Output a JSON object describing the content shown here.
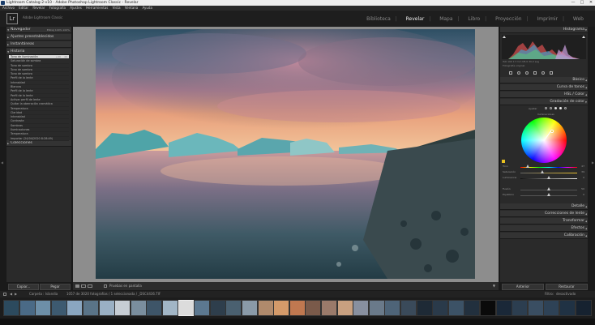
{
  "window": {
    "title": "Lightroom Catalog-2-v10 - Adobe Photoshop Lightroom Classic - Revelar",
    "min": "—",
    "max": "□",
    "close": "✕"
  },
  "menu": [
    "Archivo",
    "Editar",
    "Revelar",
    "Fotografía",
    "Ajustes",
    "Herramientas",
    "Vista",
    "Ventana",
    "Ayuda"
  ],
  "identity": {
    "logo": "Lr",
    "catalog": "Adobe Lightroom Classic"
  },
  "modules": [
    {
      "label": "Biblioteca",
      "active": false
    },
    {
      "label": "Revelar",
      "active": true
    },
    {
      "label": "Mapa",
      "active": false
    },
    {
      "label": "Libro",
      "active": false
    },
    {
      "label": "Proyección",
      "active": false
    },
    {
      "label": "Imprimir",
      "active": false
    },
    {
      "label": "Web",
      "active": false
    }
  ],
  "left_panel": {
    "navigator": "Navegador",
    "navigator_zoom": "ENCAJ  100%  100%",
    "presets": "Ajustes preestablecidos",
    "snapshots": "Instantáneas",
    "history": "Historia",
    "collections": "Colecciones",
    "history_items": [
      {
        "label": "Tono de iluminación",
        "v1": "+46",
        "v2": "46",
        "selected": true
      },
      {
        "label": "Saturación de sombra",
        "v1": "",
        "v2": "",
        "selected": false
      },
      {
        "label": "Tono de sombra",
        "v1": "",
        "v2": "",
        "selected": false
      },
      {
        "label": "Tono de sombra",
        "v1": "",
        "v2": "",
        "selected": false
      },
      {
        "label": "Tono de sombra",
        "v1": "",
        "v2": "",
        "selected": false
      },
      {
        "label": "Perfil de la lente",
        "v1": "",
        "v2": "",
        "selected": false
      },
      {
        "label": "Intensidad",
        "v1": "",
        "v2": "",
        "selected": false
      },
      {
        "label": "Blancos",
        "v1": "",
        "v2": "",
        "selected": false
      },
      {
        "label": "Perfil de la lente",
        "v1": "",
        "v2": "",
        "selected": false
      },
      {
        "label": "Perfil de la lente",
        "v1": "",
        "v2": "",
        "selected": false
      },
      {
        "label": "Activar perfil de lente",
        "v1": "",
        "v2": "",
        "selected": false
      },
      {
        "label": "Quitar la aberración cromática",
        "v1": "",
        "v2": "",
        "selected": false
      },
      {
        "label": "Temperatura",
        "v1": "",
        "v2": "",
        "selected": false
      },
      {
        "label": "Claridad",
        "v1": "",
        "v2": "",
        "selected": false
      },
      {
        "label": "Intensidad",
        "v1": "",
        "v2": "",
        "selected": false
      },
      {
        "label": "Contraste",
        "v1": "",
        "v2": "",
        "selected": false
      },
      {
        "label": "Sombras",
        "v1": "",
        "v2": "",
        "selected": false
      },
      {
        "label": "Iluminaciones",
        "v1": "",
        "v2": "",
        "selected": false
      },
      {
        "label": "Temperatura",
        "v1": "",
        "v2": "",
        "selected": false
      },
      {
        "label": "Importar (24/04/2020 8:28:49)",
        "v1": "",
        "v2": "",
        "selected": false
      }
    ],
    "copy_btn": "Copiar...",
    "paste_btn": "Pegar"
  },
  "right_panel": {
    "histogram": "Histograma",
    "hist_stats": "ISO 100   17 mm   f/8,0   30,0 seg",
    "original_photo": "Fotografía original",
    "basic": "Básico",
    "tone_curve": "Curva de tonos",
    "hsl": "HSL / Color",
    "grading": "Gradación de color",
    "grading_adjust": "Ajustar",
    "grading_wheel_label": "Iluminaciones",
    "sliders": [
      {
        "label": "Tono",
        "value": "47",
        "pos": 0.13
      },
      {
        "label": "Saturación",
        "value": "39",
        "pos": 0.39
      },
      {
        "label": "Luminancia",
        "value": "0",
        "pos": 0.5
      },
      {
        "label": "Fusión",
        "value": "50",
        "pos": 0.5
      },
      {
        "label": "Equilibrio",
        "value": "0",
        "pos": 0.5
      }
    ],
    "detail": "Detalle",
    "lens": "Correcciones de lente",
    "transform": "Transformar",
    "effects": "Efectos",
    "calibration": "Calibración",
    "previous_btn": "Anterior",
    "reset_btn": "Restaurar"
  },
  "toolbar": {
    "label": "Pruebas en pantalla"
  },
  "filmstrip_bar": {
    "source": "Carpeta : Islandia",
    "count": "1057 de 3020 fotografías / 1 seleccionada / _DSC4436.TIF",
    "filter": "Filtro:",
    "filter_value": "desactivado"
  },
  "colors": {
    "panel_bg": "#2a2a2a",
    "accent_active": "#eeeeee",
    "selected_row": "#d9d9d9"
  }
}
